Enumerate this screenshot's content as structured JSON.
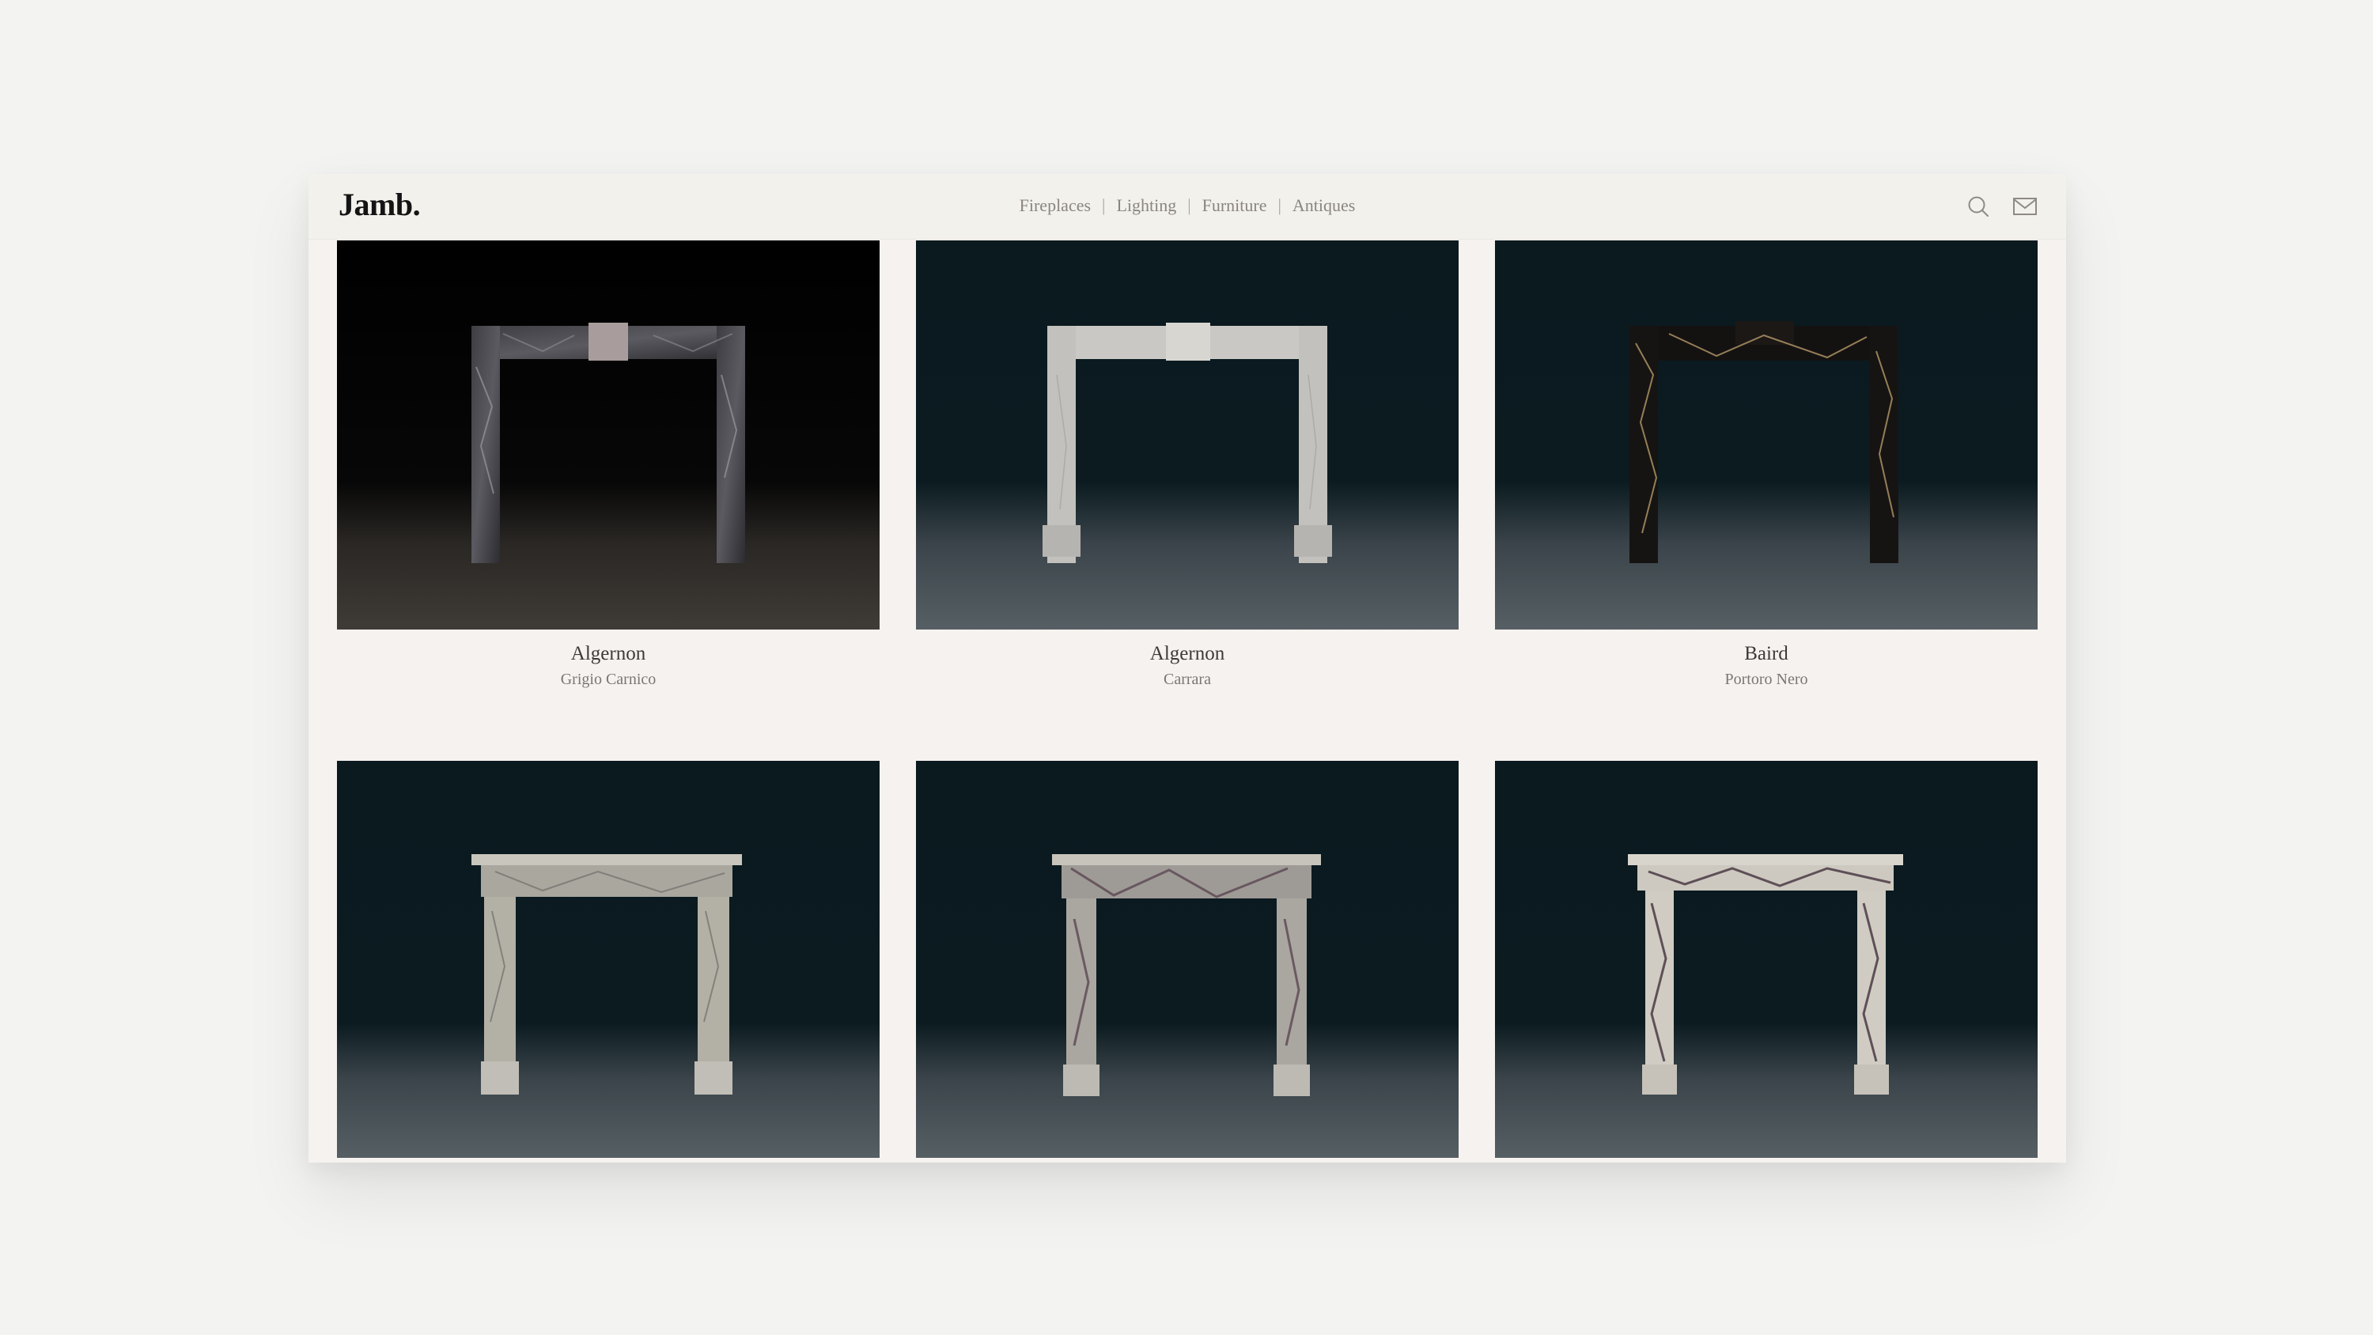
{
  "brand": {
    "logo": "Jamb."
  },
  "nav": {
    "items": [
      {
        "label": "Fireplaces",
        "separator": "|"
      },
      {
        "label": "Lighting",
        "separator": "|"
      },
      {
        "label": "Furniture",
        "separator": "|"
      },
      {
        "label": "Antiques",
        "separator": ""
      }
    ]
  },
  "icons": {
    "search": "search-icon",
    "mail": "mail-icon"
  },
  "products": [
    {
      "name": "Algernon",
      "material": "Grigio Carnico"
    },
    {
      "name": "Algernon",
      "material": "Carrara"
    },
    {
      "name": "Baird",
      "material": "Portoro Nero"
    },
    {
      "name": "",
      "material": ""
    },
    {
      "name": "",
      "material": ""
    },
    {
      "name": "",
      "material": ""
    }
  ],
  "colors": {
    "page_bg": "#f3f3f2",
    "window_bg": "#f6f2ef",
    "header_bg": "#f3f1ec",
    "photo_bg_teal": "#0b1c21",
    "photo_bg_black": "#010101",
    "text_dark": "#3c3a38",
    "text_muted": "#7a7672"
  }
}
